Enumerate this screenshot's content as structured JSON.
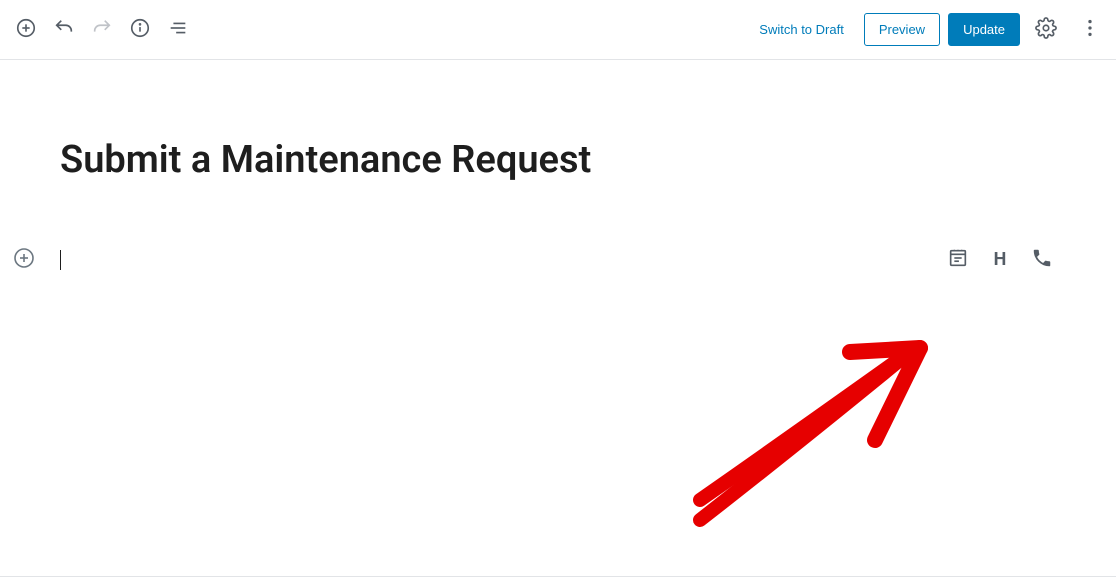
{
  "toolbar": {
    "switch_to_draft": "Switch to Draft",
    "preview": "Preview",
    "update": "Update"
  },
  "post": {
    "title": "Submit a Maintenance Request"
  },
  "block_suggestions": {
    "heading_glyph": "H"
  },
  "icons": {
    "add": "add-icon",
    "undo": "undo-icon",
    "redo": "redo-icon",
    "info": "info-icon",
    "outline": "document-outline-icon",
    "settings": "gear-icon",
    "more": "more-vertical-icon",
    "form": "form-icon",
    "heading": "heading-icon",
    "phone": "phone-icon"
  }
}
